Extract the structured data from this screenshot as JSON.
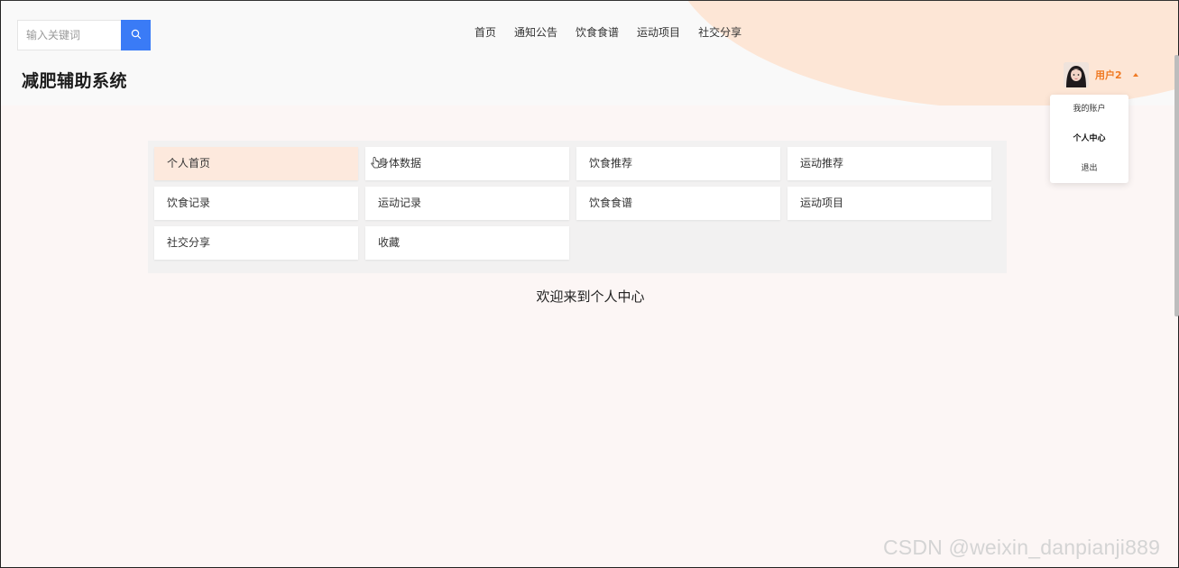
{
  "search": {
    "placeholder": "输入关键词",
    "button_icon": "search-icon"
  },
  "site": {
    "title": "减肥辅助系统"
  },
  "top_nav": {
    "items": [
      {
        "label": "首页"
      },
      {
        "label": "通知公告"
      },
      {
        "label": "饮食食谱"
      },
      {
        "label": "运动项目"
      },
      {
        "label": "社交分享"
      }
    ]
  },
  "user": {
    "name": "用户2",
    "avatar": "avatar-image",
    "caret_icon": "caret-up-icon"
  },
  "dropdown": {
    "items": [
      {
        "label": "我的账户"
      },
      {
        "label": "个人中心",
        "active": true
      },
      {
        "label": "退出"
      }
    ]
  },
  "center_menu": {
    "items": [
      {
        "label": "个人首页",
        "active": true
      },
      {
        "label": "身体数据"
      },
      {
        "label": "饮食推荐"
      },
      {
        "label": "运动推荐"
      },
      {
        "label": "饮食记录"
      },
      {
        "label": "运动记录"
      },
      {
        "label": "饮食食谱"
      },
      {
        "label": "运动项目"
      },
      {
        "label": "社交分享"
      },
      {
        "label": "收藏"
      }
    ]
  },
  "welcome": {
    "text": "欢迎来到个人中心"
  },
  "watermark": {
    "text": "CSDN @weixin_danpianji889"
  },
  "colors": {
    "accent": "#3a7bf6",
    "user_orange": "#f07a24",
    "active_cell": "#fde9dd",
    "header_blob": "#fde6d6"
  }
}
